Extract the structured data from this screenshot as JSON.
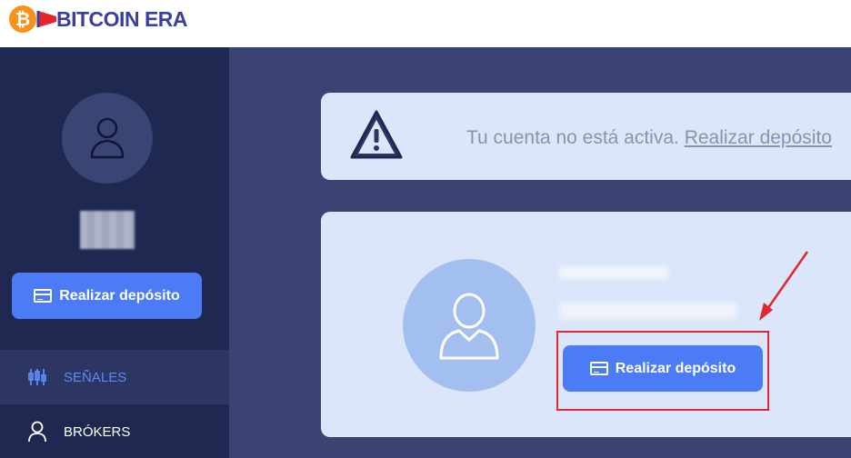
{
  "header": {
    "logo_coin": "₿",
    "logo_text": "BITCOIN ERA"
  },
  "sidebar": {
    "deposit_button": "Realizar depósito",
    "items": [
      {
        "label": "SEÑALES",
        "icon": "signals-icon",
        "active": true
      },
      {
        "label": "BRÓKERS",
        "icon": "user-icon",
        "active": false
      }
    ]
  },
  "alert": {
    "text": "Tu cuenta no está activa. ",
    "link": "Realizar depósito"
  },
  "panel": {
    "deposit_button": "Realizar depósito"
  },
  "colors": {
    "sidebar_bg": "#1f2850",
    "main_bg": "#3a4371",
    "card_bg": "#dbe6fb",
    "button": "#4b7bf5",
    "active_nav_text": "#5b8bf7",
    "highlight_border": "#e0282e",
    "logo_coin": "#f7931a",
    "logo_text": "#3a3f9e"
  }
}
